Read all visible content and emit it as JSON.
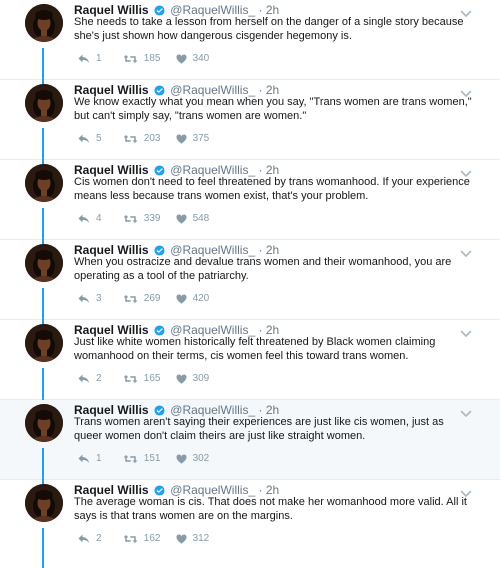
{
  "colors": {
    "thread_line": "#1da1f2",
    "verified": "#1da1f2",
    "meta_text": "#657786",
    "action_icon": "#8a9ba8",
    "highlight_bg": "#f5f8fa"
  },
  "icons": {
    "verified": "verified-badge-icon",
    "reply": "reply-icon",
    "retweet": "retweet-icon",
    "like": "heart-icon",
    "more": "chevron-down-icon"
  },
  "tweets": [
    {
      "name": "Raquel Willis",
      "handle": "@RaquelWillis_",
      "time": "2h",
      "text": "She needs to take a lesson from herself on the danger of a single story because she's just shown how dangerous cisgender hegemony is.",
      "replies": "1",
      "retweets": "185",
      "likes": "340"
    },
    {
      "name": "Raquel Willis",
      "handle": "@RaquelWillis_",
      "time": "2h",
      "text": "We know exactly what you mean when you say, \"Trans women are trans women,\" but can't simply say, \"trans women are women.\"",
      "replies": "5",
      "retweets": "203",
      "likes": "375"
    },
    {
      "name": "Raquel Willis",
      "handle": "@RaquelWillis_",
      "time": "2h",
      "text": "Cis women don't need to feel threatened by trans womanhood. If your experience means less because trans women exist, that's your problem.",
      "replies": "4",
      "retweets": "339",
      "likes": "548"
    },
    {
      "name": "Raquel Willis",
      "handle": "@RaquelWillis_",
      "time": "2h",
      "text": "When you ostracize and devalue trans women and their womanhood, you are operating as a tool of the patriarchy.",
      "replies": "3",
      "retweets": "269",
      "likes": "420"
    },
    {
      "name": "Raquel Willis",
      "handle": "@RaquelWillis_",
      "time": "2h",
      "text": "Just like white women historically felt threatened by Black women claiming womanhood on their terms, cis women feel this toward trans women.",
      "replies": "2",
      "retweets": "165",
      "likes": "309"
    },
    {
      "name": "Raquel Willis",
      "handle": "@RaquelWillis_",
      "time": "2h",
      "text": "Trans women aren't saying their experiences are just like cis women, just as queer women don't claim theirs are just like straight women.",
      "replies": "1",
      "retweets": "151",
      "likes": "302"
    },
    {
      "name": "Raquel Willis",
      "handle": "@RaquelWillis_",
      "time": "2h",
      "text": "The average woman is cis. That does not make her womanhood more valid. All it says is that trans women are on the margins.",
      "replies": "2",
      "retweets": "162",
      "likes": "312"
    }
  ]
}
